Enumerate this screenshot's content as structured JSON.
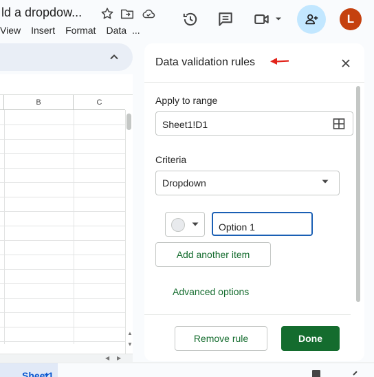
{
  "doc": {
    "title": "ld a dropdow..."
  },
  "menu": [
    "View",
    "Insert",
    "Format",
    "Data",
    "..."
  ],
  "account": {
    "avatar_letter": "L",
    "avatar_color": "#c5410f"
  },
  "sheet": {
    "columns": [
      "B",
      "C"
    ],
    "tab_label": "Sheet1"
  },
  "panel": {
    "title": "Data validation rules",
    "apply_label": "Apply to range",
    "range_value": "Sheet1!D1",
    "criteria_label": "Criteria",
    "criteria_value": "Dropdown",
    "option_value": "Option 1",
    "add_item_label": "Add another item",
    "advanced_label": "Advanced options",
    "remove_label": "Remove rule",
    "done_label": "Done"
  },
  "colors": {
    "accent_green": "#146c2e",
    "focus_blue": "#1a5fb4",
    "share_bg": "#c2e7ff",
    "annotation_red": "#e2231a"
  }
}
